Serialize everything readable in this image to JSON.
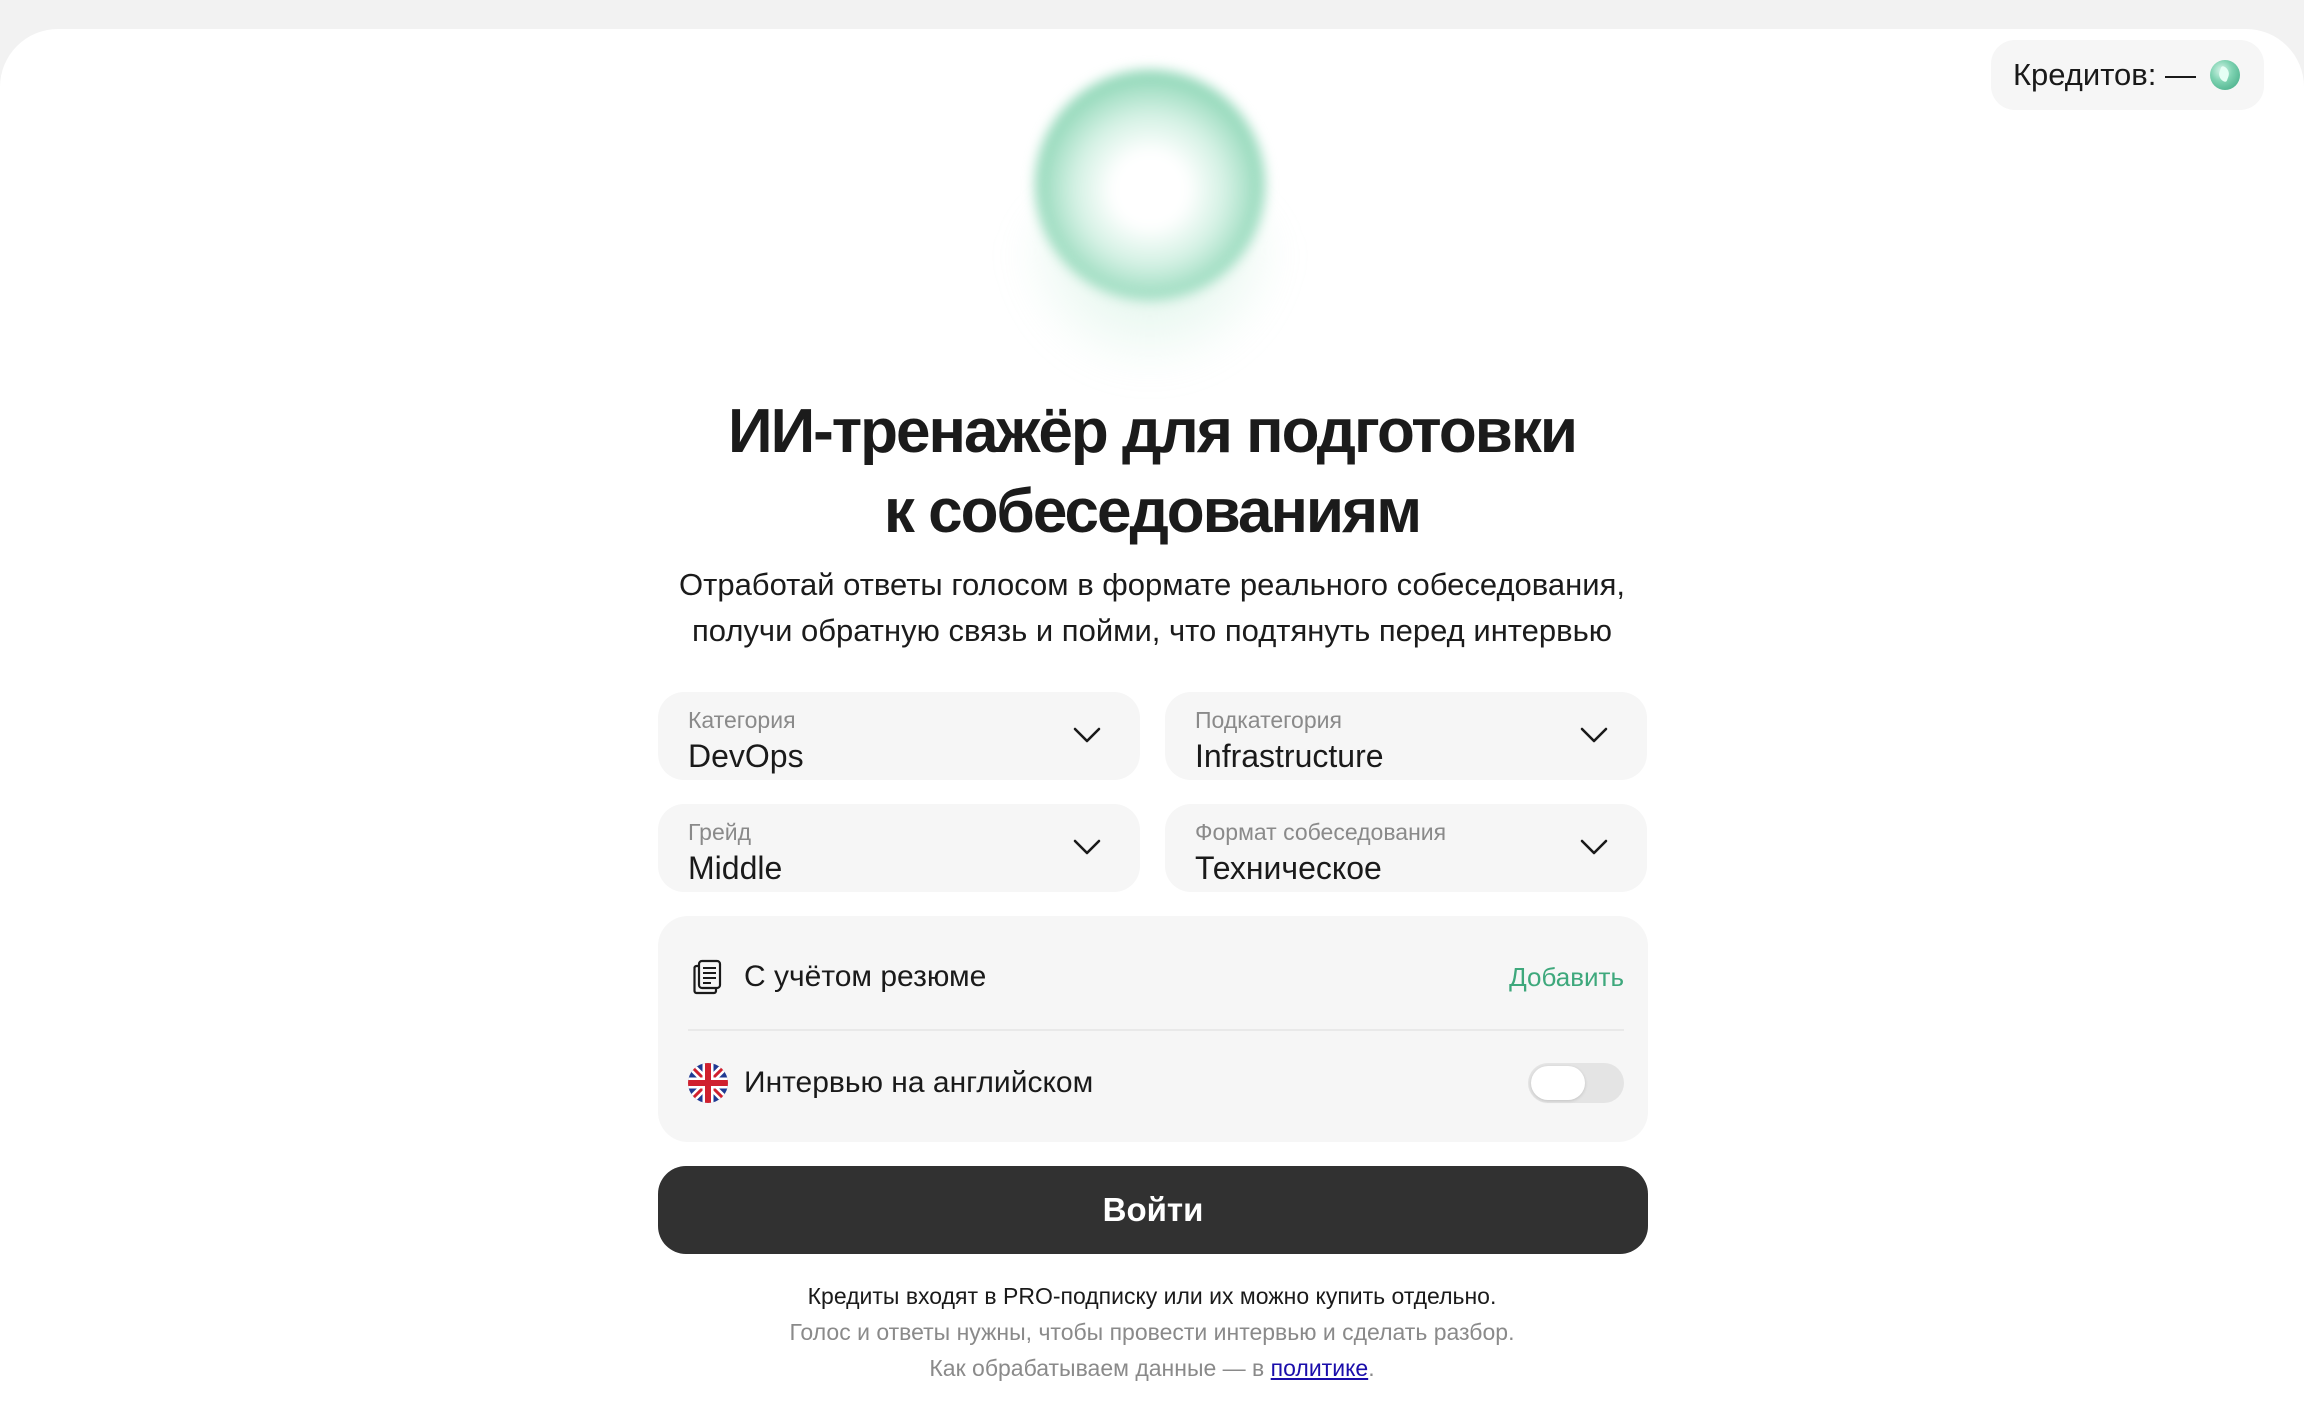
{
  "credits": {
    "label": "Кредитов: —",
    "icon": "leaf-coin-icon"
  },
  "hero": {
    "title_line1": "ИИ-тренажёр для подготовки",
    "title_line2": "к собеседованиям",
    "subtitle_line1": "Отработай ответы голосом в формате реального собеседования,",
    "subtitle_line2": "получи обратную связь и пойми, что подтянуть перед интервью"
  },
  "form": {
    "category": {
      "label": "Категория",
      "value": "DevOps"
    },
    "subcategory": {
      "label": "Подкатегория",
      "value": "Infrastructure"
    },
    "grade": {
      "label": "Грейд",
      "value": "Middle"
    },
    "format": {
      "label": "Формат собеседования",
      "value": "Техническое"
    }
  },
  "options": {
    "resume": {
      "label": "С учётом резюме",
      "action": "Добавить"
    },
    "english": {
      "label": "Интервью на английском",
      "enabled": false
    }
  },
  "login_button": "Войти",
  "footer": {
    "line1": "Кредиты входят в PRO-подписку или их можно купить отдельно.",
    "line2": "Голос и ответы нужны, чтобы провести интервью и сделать разбор.",
    "line3_prefix": "Как обрабатываем данные — в ",
    "line3_link": "политике",
    "line3_suffix": "."
  },
  "colors": {
    "accent": "#3ea87c",
    "button": "#313131",
    "field_bg": "#f6f6f6"
  }
}
